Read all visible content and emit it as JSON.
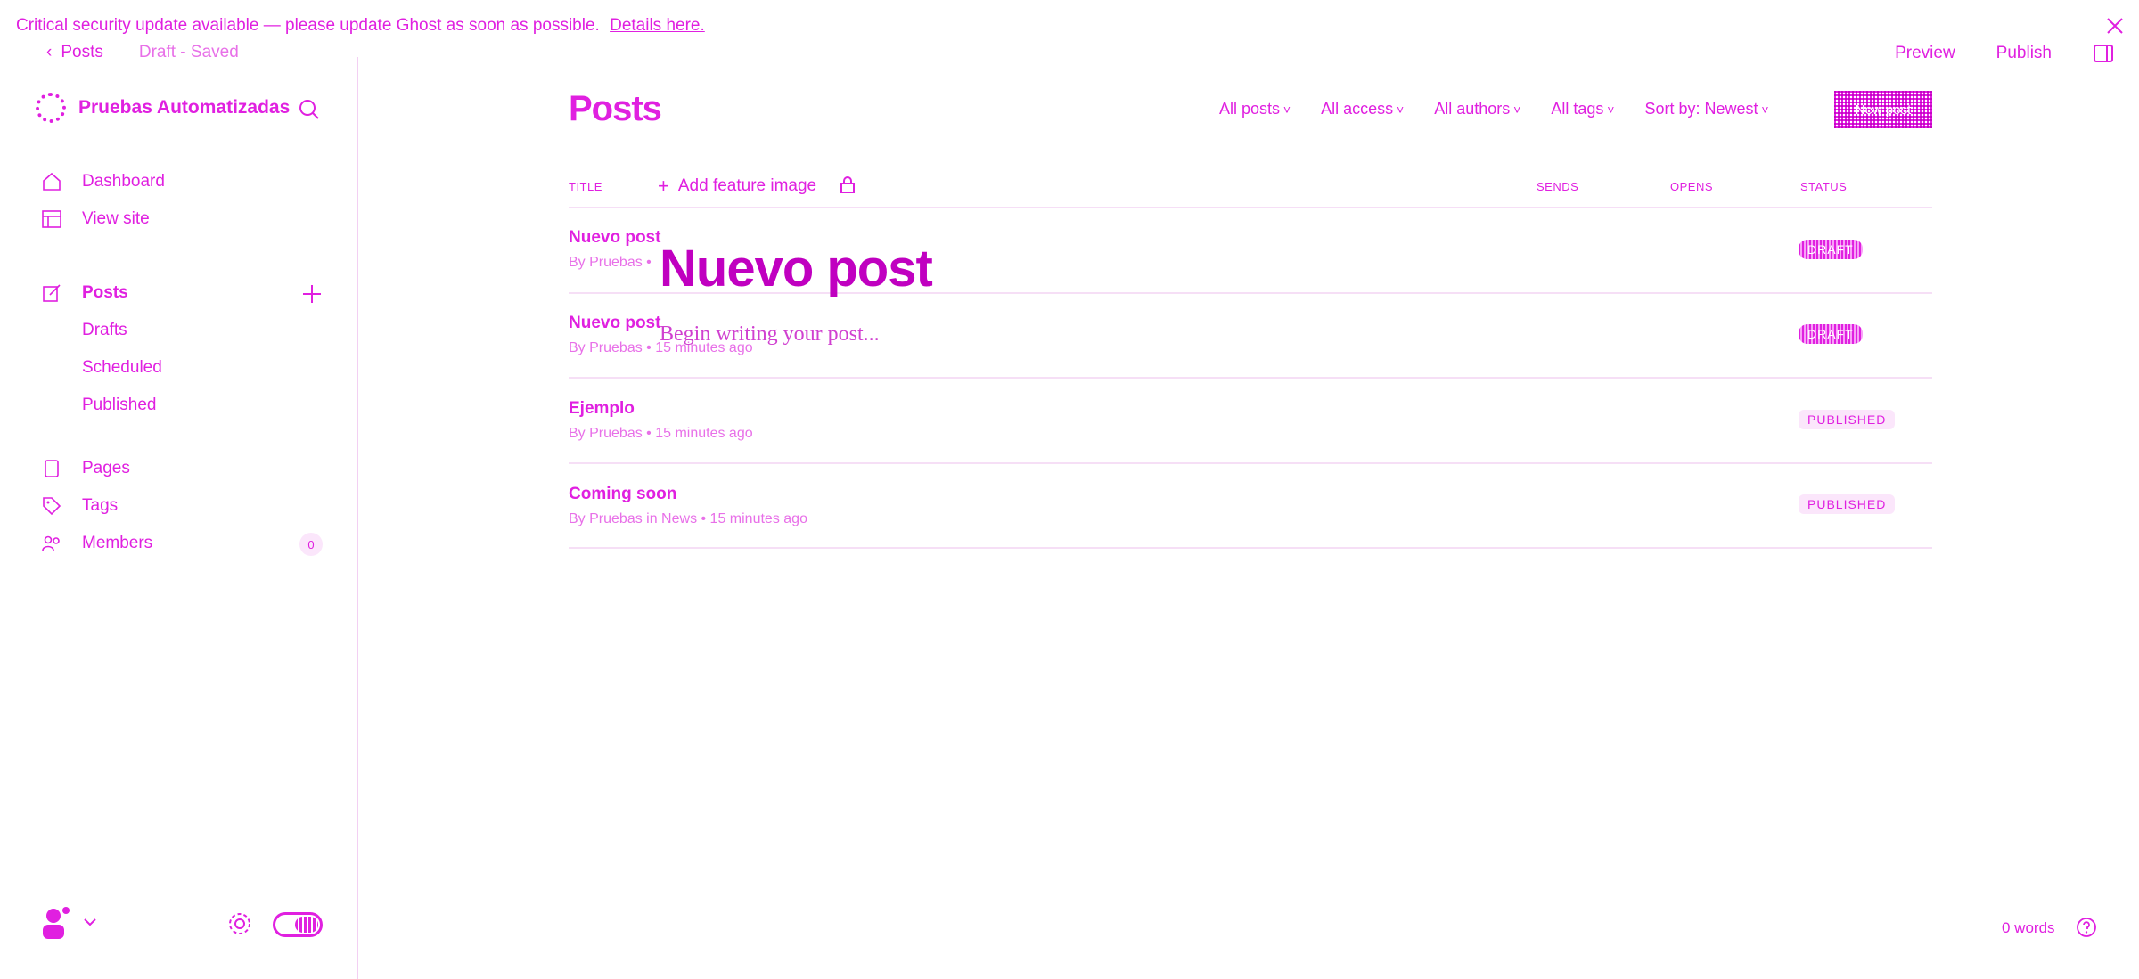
{
  "banner": {
    "text": "Critical security update available — please update Ghost as soon as possible.",
    "link": "Details here."
  },
  "topbar": {
    "back_label": "Posts",
    "status": "Draft - Saved",
    "preview_label": "Preview",
    "publish_label": "Publish"
  },
  "sidebar": {
    "site_name": "Pruebas Automatizadas",
    "nav": [
      {
        "label": "Dashboard",
        "icon": "home-icon"
      },
      {
        "label": "View site",
        "icon": "window-icon"
      },
      {
        "label": "Posts",
        "icon": "edit-icon"
      },
      {
        "label": "Pages",
        "icon": "page-icon"
      },
      {
        "label": "Tags",
        "icon": "tag-icon"
      },
      {
        "label": "Members",
        "icon": "members-icon"
      }
    ],
    "posts_sub": [
      "Drafts",
      "Scheduled",
      "Published"
    ],
    "members_count": "0"
  },
  "main": {
    "title": "Posts",
    "filters": [
      "All posts",
      "All access",
      "All authors",
      "All tags",
      "Sort by: Newest"
    ],
    "new_post_label": "New post",
    "columns": {
      "title": "TITLE",
      "sends": "SENDS",
      "opens": "OPENS",
      "status": "STATUS"
    },
    "add_feature_label": "Add feature image",
    "rows": [
      {
        "title": "Nuevo post",
        "meta": "By Pruebas •",
        "status": "DRAFT"
      },
      {
        "title": "Nuevo post",
        "meta": "By Pruebas • 15 minutes ago",
        "status": "DRAFT"
      },
      {
        "title": "Ejemplo",
        "meta": "By Pruebas • 15 minutes ago",
        "status": "PUBLISHED"
      },
      {
        "title": "Coming soon",
        "meta": "By Pruebas in News • 15 minutes ago",
        "status": "PUBLISHED"
      }
    ]
  },
  "editor": {
    "title": "Nuevo post",
    "placeholder": "Begin writing your post..."
  },
  "footer": {
    "word_count": "0 words"
  },
  "colors": {
    "accent": "#e020e0",
    "divider": "#f6dff6"
  }
}
